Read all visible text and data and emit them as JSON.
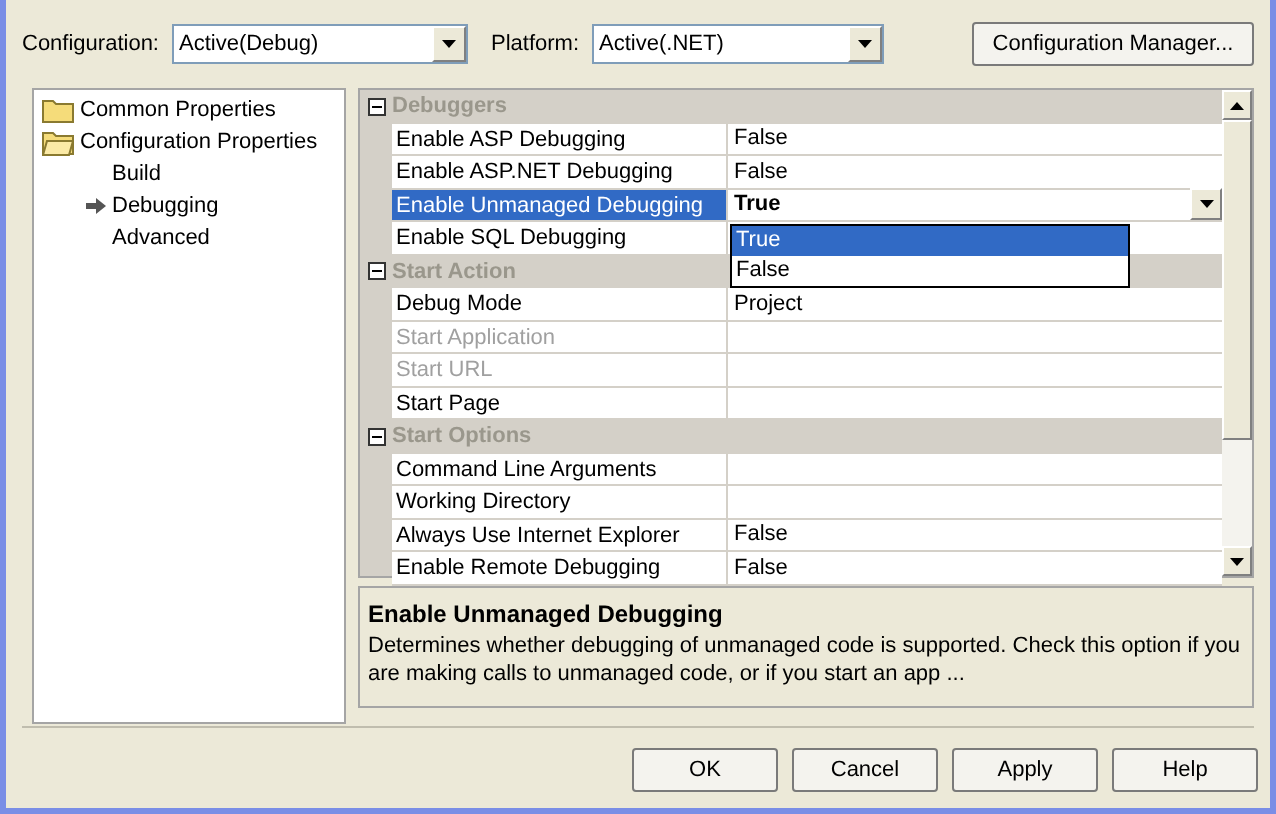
{
  "toolbar": {
    "configuration_label": "Configuration:",
    "configuration_value": "Active(Debug)",
    "platform_label": "Platform:",
    "platform_value": "Active(.NET)",
    "manager_button": "Configuration Manager..."
  },
  "tree": [
    {
      "label": "Common Properties",
      "expanded": false,
      "selected": false
    },
    {
      "label": "Configuration Properties",
      "expanded": true,
      "selected": false,
      "children": [
        {
          "label": "Build",
          "selected": false
        },
        {
          "label": "Debugging",
          "selected": true
        },
        {
          "label": "Advanced",
          "selected": false
        }
      ]
    }
  ],
  "grid": {
    "rows": [
      {
        "kind": "category",
        "label": "Debuggers",
        "expanded": true
      },
      {
        "kind": "property",
        "label": "Enable ASP Debugging",
        "value": "False",
        "disabled": false,
        "selected": false
      },
      {
        "kind": "property",
        "label": "Enable ASP.NET Debugging",
        "value": "False",
        "disabled": false,
        "selected": false
      },
      {
        "kind": "property",
        "label": "Enable Unmanaged Debugging",
        "value": "True",
        "disabled": false,
        "selected": true,
        "dropdown": [
          {
            "label": "True",
            "selected": true
          },
          {
            "label": "False",
            "selected": false
          }
        ]
      },
      {
        "kind": "property",
        "label": "Enable SQL Debugging",
        "disabled": false,
        "selected": false
      },
      {
        "kind": "category",
        "label": "Start Action",
        "expanded": true
      },
      {
        "kind": "property",
        "label": "Debug Mode",
        "value": "Project",
        "disabled": false,
        "selected": false
      },
      {
        "kind": "property",
        "label": "Start Application",
        "disabled": true,
        "selected": false
      },
      {
        "kind": "property",
        "label": "Start URL",
        "disabled": true,
        "selected": false
      },
      {
        "kind": "property",
        "label": "Start Page",
        "disabled": false,
        "selected": false
      },
      {
        "kind": "category",
        "label": "Start Options",
        "expanded": true
      },
      {
        "kind": "property",
        "label": "Command Line Arguments",
        "disabled": false,
        "selected": false
      },
      {
        "kind": "property",
        "label": "Working Directory",
        "disabled": false,
        "selected": false
      },
      {
        "kind": "property",
        "label": "Always Use Internet Explorer",
        "value": "False",
        "disabled": false,
        "selected": false
      },
      {
        "kind": "property",
        "label": "Enable Remote Debugging",
        "value": "False",
        "disabled": false,
        "selected": false
      }
    ]
  },
  "description": {
    "title": "Enable Unmanaged Debugging",
    "text": "Determines whether debugging of unmanaged code is supported. Check this option if you are making calls to unmanaged code, or if you start an app ..."
  },
  "buttons": [
    "OK",
    "Cancel",
    "Apply",
    "Help"
  ]
}
